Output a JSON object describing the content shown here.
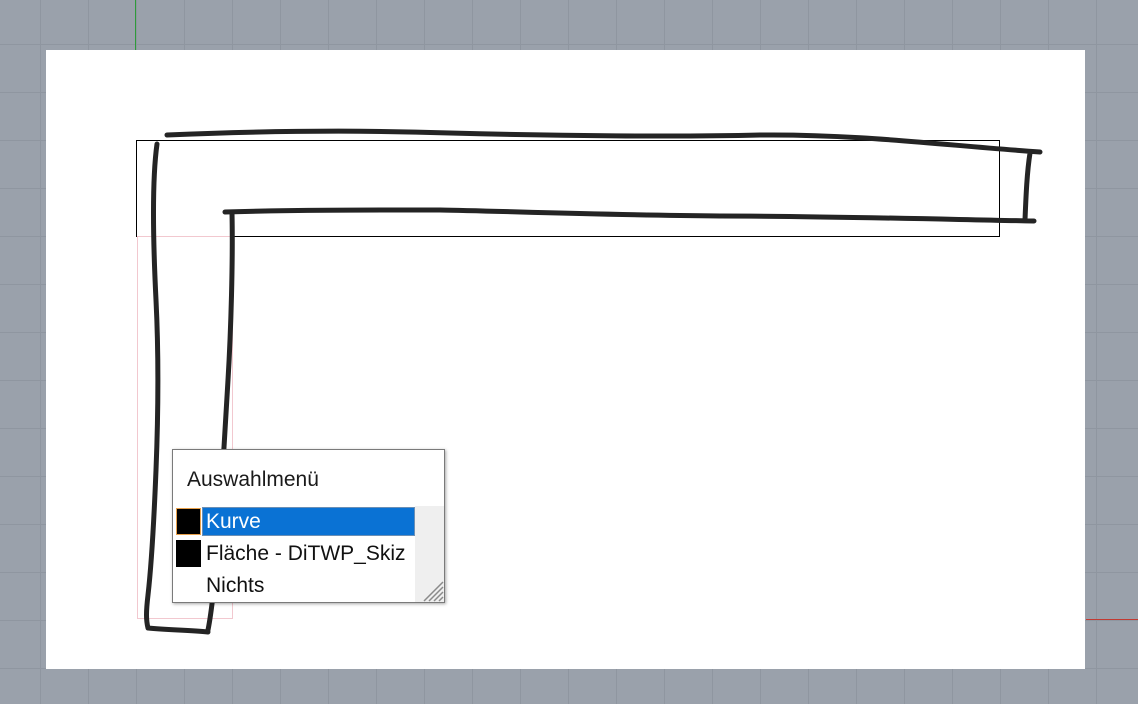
{
  "app": {
    "background_color": "#9aa1ab",
    "sheet_color": "#ffffff",
    "y_axis_color": "#2e9b3a",
    "x_axis_color": "#c23a32"
  },
  "selection_menu": {
    "title": "Auswahlmenü",
    "highlight_color": "#0a72d4",
    "items": [
      {
        "label": "Kurve",
        "swatch_color": "#000000",
        "selected": true
      },
      {
        "label": "Fläche - DiTWP_Skiz",
        "swatch_color": "#000000",
        "selected": false
      },
      {
        "label": "Nichts",
        "swatch_color": "",
        "selected": false
      }
    ]
  }
}
